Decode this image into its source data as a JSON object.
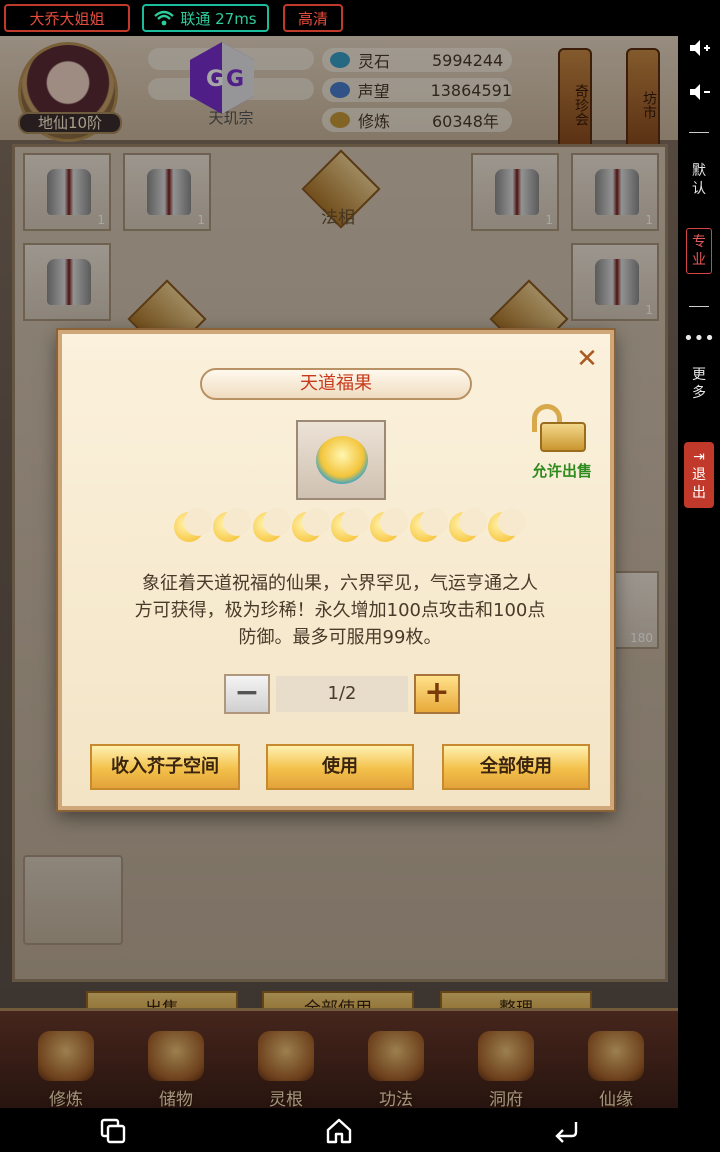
{
  "status_bar": {
    "user_label": "大乔大姐姐",
    "network_label": "联通 27ms",
    "quality_label": "高清"
  },
  "side_panel": {
    "default_label": "默认",
    "pro_label": "专业",
    "more_label": "更多",
    "exit_label": "退出"
  },
  "player": {
    "rank": "地仙10阶",
    "sect": "天玑宗",
    "stats": [
      {
        "label": "灵石",
        "value": "5994244",
        "icon": "spirit-stone-icon"
      },
      {
        "label": "声望",
        "value": "13864591",
        "icon": "reputation-icon"
      },
      {
        "label": "修炼",
        "value": "60348年",
        "icon": "cultivation-icon"
      }
    ]
  },
  "lanterns": {
    "treasure": "奇珍会",
    "market": "坊市"
  },
  "inventory": {
    "fa_xiang_label": "法相",
    "counts": [
      "1",
      "1",
      "1",
      "1",
      "1",
      "1"
    ],
    "slot_count_180": "180"
  },
  "bottom_buttons": {
    "sell": "出售",
    "use_all": "全部使用",
    "arrange": "整理"
  },
  "nav": [
    {
      "label": "修炼",
      "icon": "cultivate-icon"
    },
    {
      "label": "储物",
      "icon": "storage-bag-icon"
    },
    {
      "label": "灵根",
      "icon": "spirit-root-icon"
    },
    {
      "label": "功法",
      "icon": "technique-book-icon"
    },
    {
      "label": "洞府",
      "icon": "cave-dwelling-icon"
    },
    {
      "label": "仙缘",
      "icon": "fate-icon"
    }
  ],
  "modal": {
    "title": "天道福果",
    "lock_label": "允许出售",
    "star_count": 9,
    "description_lines": [
      "象征着天道祝福的仙果，六界罕见，气运亨通之人",
      "方可获得，极为珍稀！永久增加100点攻击和100点",
      "防御。最多可服用99枚。"
    ],
    "quantity": "1/2",
    "buttons": {
      "store": "收入芥子空间",
      "use": "使用",
      "use_all": "全部使用"
    }
  },
  "colors": {
    "accent_red": "#c83a1c",
    "gold": "#f3c04a",
    "allow_green": "#2e8b1e"
  }
}
